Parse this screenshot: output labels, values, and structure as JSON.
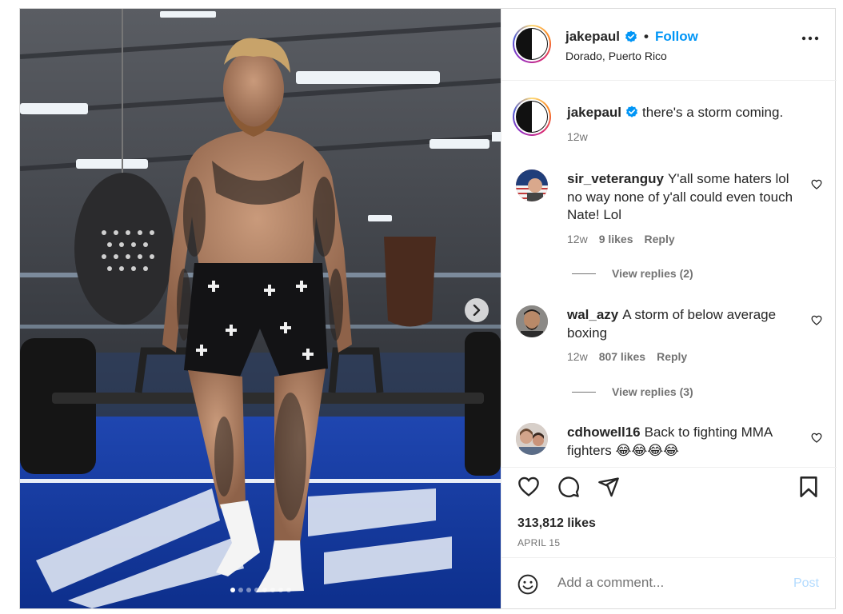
{
  "post": {
    "author": "jakepaul",
    "location": "Dorado, Puerto Rico",
    "follow_label": "Follow",
    "separator": "•",
    "caption": "there's a storm coming.",
    "caption_time": "12w",
    "likes_text": "313,812 likes",
    "date": "APRIL 15",
    "carousel_count": 8,
    "carousel_active": 0
  },
  "comments": [
    {
      "user": "sir_veteranguy",
      "text": "Y'all some haters lol no way none of y'all could even touch Nate! Lol",
      "time": "12w",
      "likes": "9 likes",
      "reply": "Reply",
      "view_replies": "View replies (2)"
    },
    {
      "user": "wal_azy",
      "text": "A storm of below average boxing",
      "time": "12w",
      "likes": "807 likes",
      "reply": "Reply",
      "view_replies": "View replies (3)"
    },
    {
      "user": "cdhowell16",
      "text": "Back to fighting MMA fighters 😂😂😂😂"
    }
  ],
  "add_comment": {
    "placeholder": "Add a comment...",
    "post_label": "Post"
  },
  "colors": {
    "accent": "#0095f6",
    "muted": "#737373",
    "text": "#262626",
    "post_disabled": "#b3dbff"
  },
  "icons": [
    "verified-badge-icon",
    "more-options-icon",
    "heart-icon",
    "comment-icon",
    "share-icon",
    "bookmark-icon",
    "emoji-icon",
    "chevron-right-icon"
  ]
}
